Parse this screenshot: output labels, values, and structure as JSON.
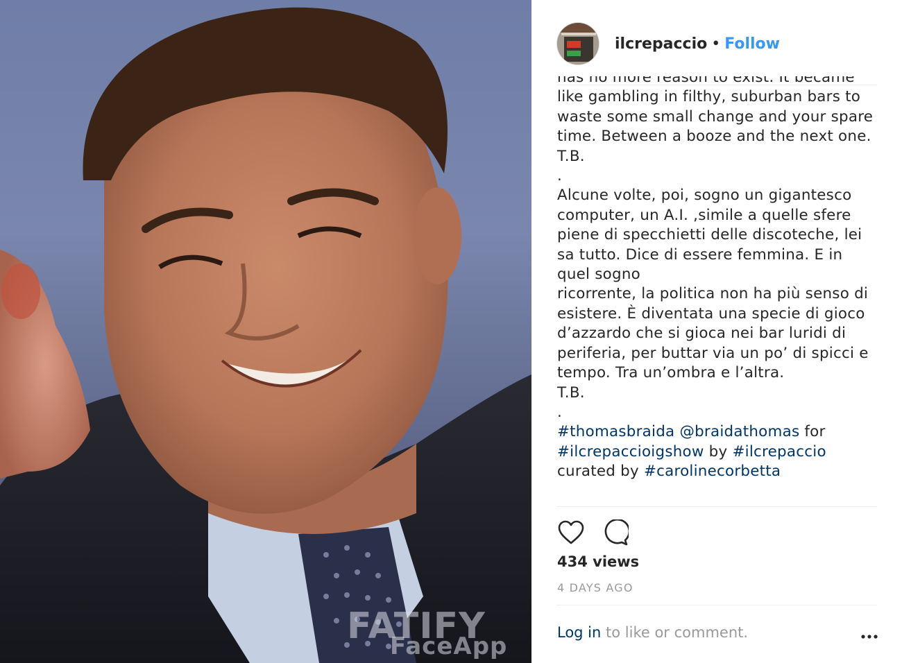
{
  "post": {
    "media": {
      "watermark_big": "FATIFY",
      "watermark_small": "FaceApp"
    },
    "header": {
      "username": "ilcrepaccio",
      "separator": "•",
      "follow_label": "Follow"
    },
    "caption": {
      "lines": [
        "has no more reason to exist. It became",
        "like gambling in filthy, suburban bars to",
        "waste some small change and your spare",
        "time. Between a booze and the next one.",
        "T.B.",
        ".",
        "Alcune volte, poi, sogno un gigantesco",
        "computer, un A.I. ,simile a quelle sfere",
        "piene di specchietti delle discoteche, lei",
        "sa tutto. Dice di essere femmina. E in",
        "quel sogno",
        "ricorrente, la politica non ha più senso di",
        "esistere. È diventata una specie di gioco",
        "d’azzardo che si gioca nei bar luridi di",
        "periferia, per buttar via un po’ di spicci e",
        "tempo. Tra un’ombra e l’altra.",
        "T.B.",
        "."
      ],
      "tags_line1": {
        "tag1": "#thomasbraida",
        "mention": "@braidathomas",
        "text": "for"
      },
      "tags_line2": {
        "tag": "#ilcrepaccioigshow",
        "text": "by",
        "tag2": "#ilcrepaccio"
      },
      "tags_line3": {
        "text": "curated by",
        "tag": "#carolinecorbetta"
      }
    },
    "actions": {
      "like_icon": "heart-icon",
      "comment_icon": "comment-icon"
    },
    "views_label": "434 views",
    "date_label": "4 DAYS AGO",
    "footer": {
      "login_label": "Log in",
      "login_suffix": "to like or comment.",
      "more_icon": "more-options-icon"
    }
  }
}
